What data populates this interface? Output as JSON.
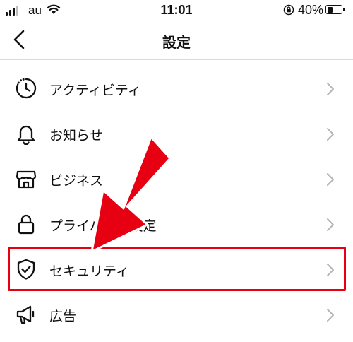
{
  "status_bar": {
    "carrier": "au",
    "time": "11:01",
    "battery_percent_text": "40%",
    "battery_level": 0.4
  },
  "header": {
    "title": "設定"
  },
  "menu": {
    "items": [
      {
        "label": "アクティビティ",
        "icon": "activity-icon"
      },
      {
        "label": "お知らせ",
        "icon": "bell-icon"
      },
      {
        "label": "ビジネス",
        "icon": "shop-icon"
      },
      {
        "label": "プライバシー設定",
        "icon": "lock-icon"
      },
      {
        "label": "セキュリティ",
        "icon": "shield-check-icon"
      },
      {
        "label": "広告",
        "icon": "megaphone-icon"
      }
    ]
  },
  "annotation": {
    "highlight_color": "#e60012",
    "arrow_color": "#e60012"
  }
}
